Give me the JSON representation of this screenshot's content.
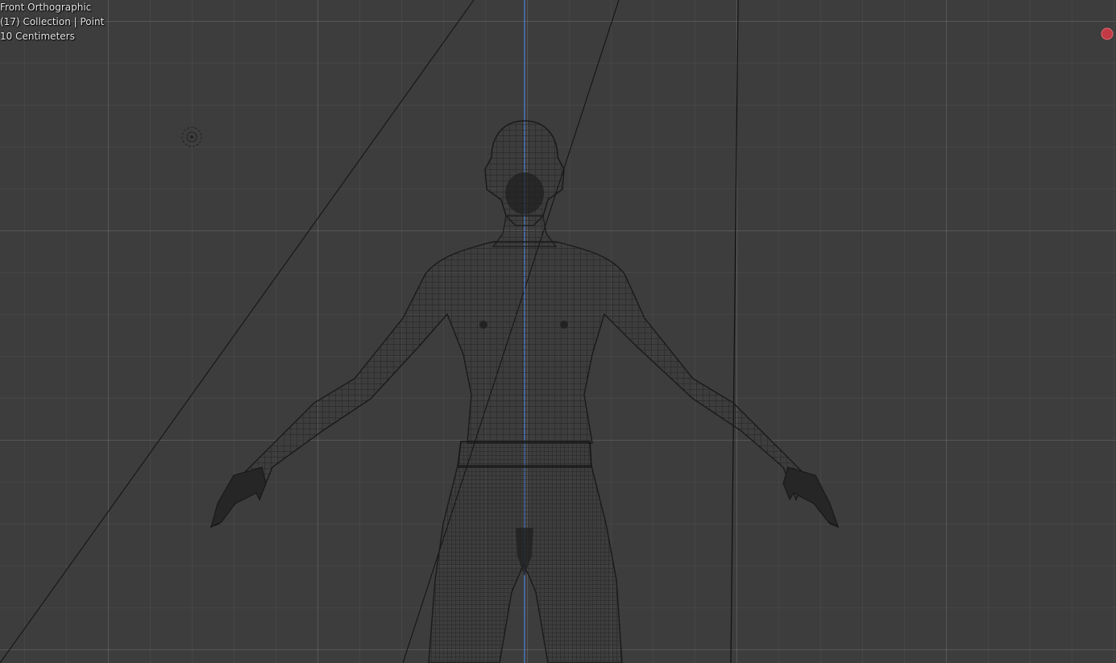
{
  "viewport": {
    "view_name": "Front Orthographic",
    "collection_info": "(17) Collection | Point",
    "grid_scale": "10 Centimeters"
  },
  "colors": {
    "background": "#3d3d3d",
    "z_axis": "#4a7bc4",
    "wire": "#1c1c1c",
    "record": "#e04a55"
  },
  "icons": {
    "light": "point-light-icon",
    "record": "record-icon"
  }
}
